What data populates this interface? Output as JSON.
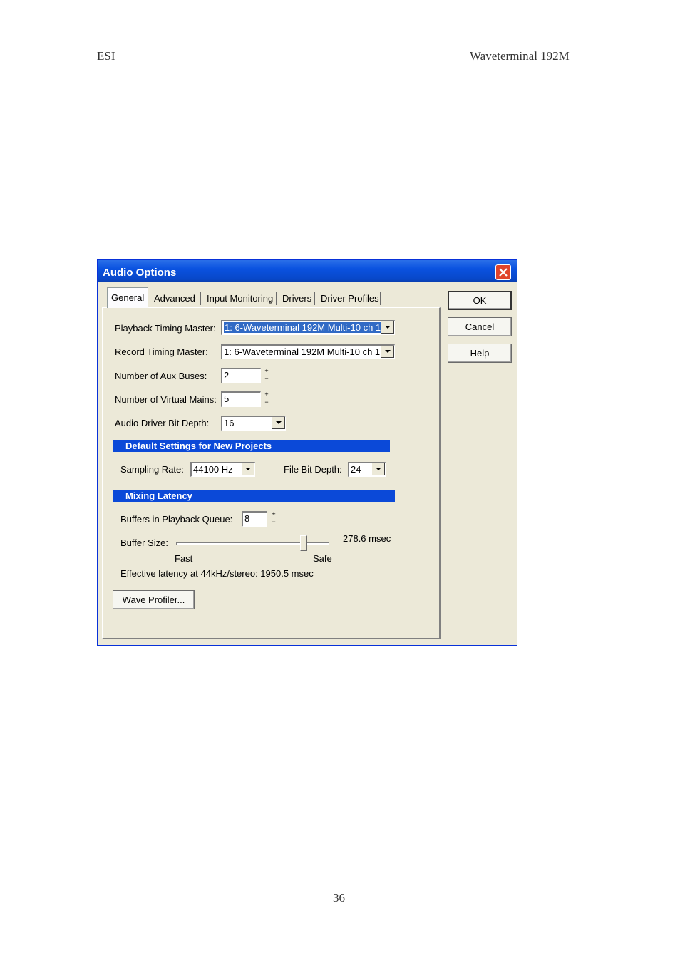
{
  "page": {
    "header_left": "ESI",
    "header_right": "Waveterminal 192M",
    "page_number": "36"
  },
  "dialog": {
    "title": "Audio Options",
    "tabs": [
      "General",
      "Advanced",
      "Input Monitoring",
      "Drivers",
      "Driver Profiles"
    ],
    "buttons": {
      "ok": "OK",
      "cancel": "Cancel",
      "help": "Help"
    },
    "general": {
      "playback_label": "Playback Timing Master:",
      "playback_value": "1: 6-Waveterminal 192M Multi-10 ch 1",
      "record_label": "Record Timing Master:",
      "record_value": "1: 6-Waveterminal 192M Multi-10 ch 1",
      "aux_label": "Number of Aux Buses:",
      "aux_value": "2",
      "mains_label": "Number of Virtual Mains:",
      "mains_value": "5",
      "bitdepth_label": "Audio Driver Bit Depth:",
      "bitdepth_value": "16",
      "defaults_header": "Default Settings for New Projects",
      "sampling_label": "Sampling Rate:",
      "sampling_value": "44100 Hz",
      "filebit_label": "File Bit Depth:",
      "filebit_value": "24",
      "latency_header": "Mixing Latency",
      "buffers_label": "Buffers in Playback Queue:",
      "buffers_value": "8",
      "buffer_size_label": "Buffer Size:",
      "buffer_size_value": "278.6 msec",
      "buffer_size_fraction": 0.88,
      "slider_fast": "Fast",
      "slider_safe": "Safe",
      "effective_latency": "Effective latency at 44kHz/stereo:  1950.5 msec",
      "wave_profiler": "Wave Profiler..."
    }
  }
}
